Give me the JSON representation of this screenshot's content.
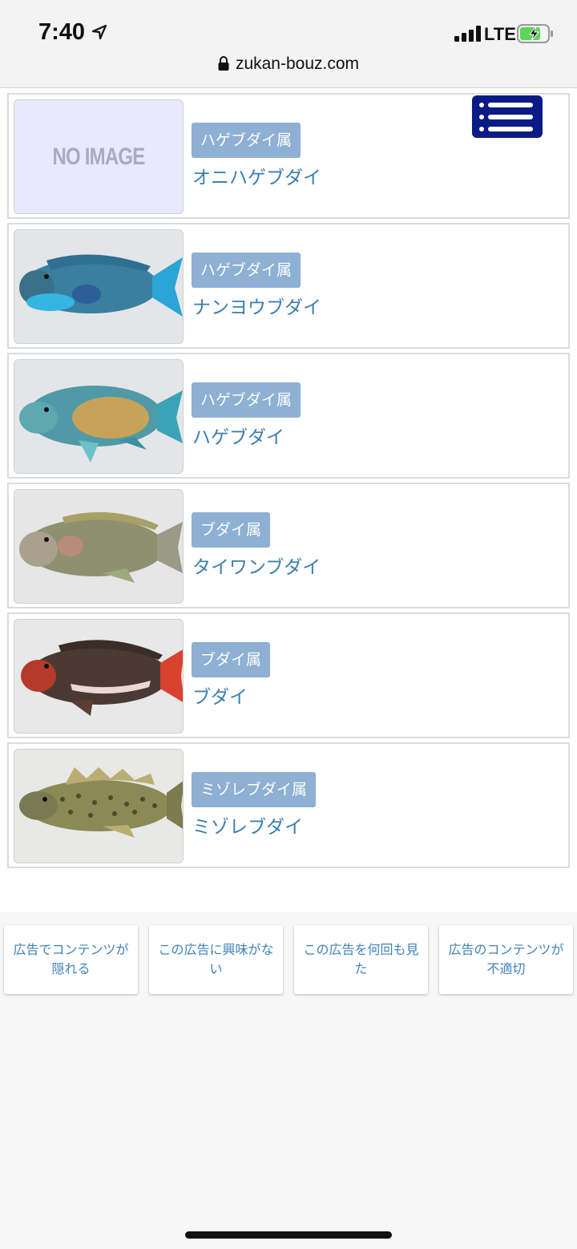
{
  "status_bar": {
    "time": "7:40",
    "network": "LTE",
    "url": "zukan-bouz.com"
  },
  "icons": {
    "location": "location-arrow-icon",
    "signal": "cellular-signal-icon",
    "battery": "battery-charging-icon",
    "lock": "lock-icon",
    "menu": "hamburger-menu-icon"
  },
  "colors": {
    "badge_bg": "#8db0d3",
    "link_text": "#3d7fae",
    "menu_bg": "#0a1a86",
    "noimage_bg": "#e8e9fb"
  },
  "fish": [
    {
      "genus": "ハゲブダイ属",
      "name": "オニハゲブダイ",
      "image": "NO IMAGE"
    },
    {
      "genus": "ハゲブダイ属",
      "name": "ナンヨウブダイ",
      "image": "photo"
    },
    {
      "genus": "ハゲブダイ属",
      "name": "ハゲブダイ",
      "image": "photo"
    },
    {
      "genus": "ブダイ属",
      "name": "タイワンブダイ",
      "image": "photo"
    },
    {
      "genus": "ブダイ属",
      "name": "ブダイ",
      "image": "photo"
    },
    {
      "genus": "ミゾレブダイ属",
      "name": "ミゾレブダイ",
      "image": "photo"
    }
  ],
  "ad_feedback": [
    "広告でコンテンツが隠れる",
    "この広告に興味がない",
    "この広告を何回も見た",
    "広告のコンテンツが不適切"
  ]
}
